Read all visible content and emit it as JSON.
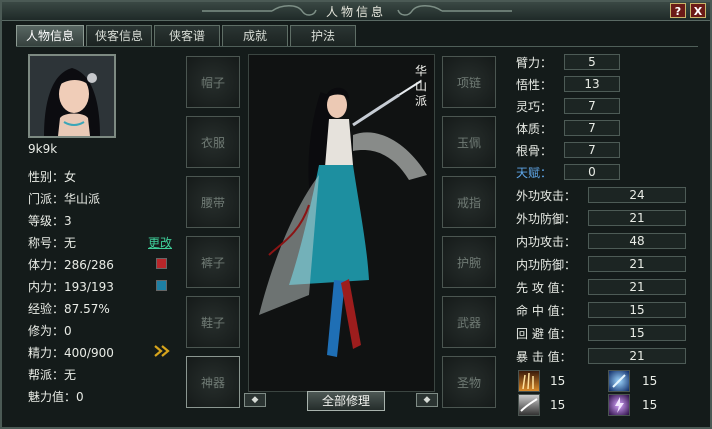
{
  "window": {
    "title": "人物信息",
    "help_label": "?",
    "close_label": "X"
  },
  "tabs": [
    "人物信息",
    "侠客信息",
    "侠客谱",
    "成就",
    "护法"
  ],
  "character": {
    "name": "9k9k",
    "faction_vertical": "华山派",
    "info": [
      {
        "label": "性别：女"
      },
      {
        "label": "门派：华山派"
      },
      {
        "label": "等级：3"
      },
      {
        "label": "称号：无",
        "action": "更改"
      },
      {
        "label": "体力：286/286",
        "color": "#b8262a"
      },
      {
        "label": "内力：193/193",
        "color": "#1e7fa3"
      },
      {
        "label": "经验：87.57%"
      },
      {
        "label": "修为：0"
      },
      {
        "label": "精力：400/900"
      },
      {
        "label": "帮派：无"
      },
      {
        "label": "魅力值：0"
      }
    ]
  },
  "equipment": {
    "left": [
      "帽子",
      "衣服",
      "腰带",
      "裤子",
      "鞋子",
      "神器"
    ],
    "right": [
      "项链",
      "玉佩",
      "戒指",
      "护腕",
      "武器",
      "圣物"
    ],
    "repair_label": "全部修理"
  },
  "attributes": [
    {
      "label": "臂力：",
      "value": "5"
    },
    {
      "label": "悟性：",
      "value": "13"
    },
    {
      "label": "灵巧：",
      "value": "7"
    },
    {
      "label": "体质：",
      "value": "7"
    },
    {
      "label": "根骨：",
      "value": "7"
    },
    {
      "label": "天赋：",
      "value": "0",
      "highlight": "#5fa6e8"
    }
  ],
  "combat_stats": [
    {
      "label": "外功攻击：",
      "value": "24"
    },
    {
      "label": "外功防御：",
      "value": "21"
    },
    {
      "label": "内功攻击：",
      "value": "48"
    },
    {
      "label": "内功防御：",
      "value": "21"
    },
    {
      "label": "先 攻 值：",
      "value": "21"
    },
    {
      "label": "命 中 值：",
      "value": "15"
    },
    {
      "label": "回 避 值：",
      "value": "15"
    },
    {
      "label": "暴 击 值：",
      "value": "21"
    }
  ],
  "resistances": [
    {
      "icon": "fire-resistance-icon",
      "value": "15"
    },
    {
      "icon": "ice-resistance-icon",
      "value": "15"
    },
    {
      "icon": "wind-resistance-icon",
      "value": "15"
    },
    {
      "icon": "lightning-resistance-icon",
      "value": "15"
    }
  ]
}
